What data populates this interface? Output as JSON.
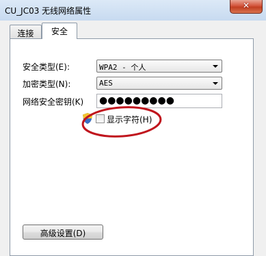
{
  "window": {
    "title": "CU_JC03 无线网络属性",
    "close_label": "✕"
  },
  "tabs": [
    {
      "label": "连接",
      "active": false
    },
    {
      "label": "安全",
      "active": true
    }
  ],
  "security": {
    "type_label": "安全类型(E):",
    "type_value": "WPA2 - 个人",
    "encryption_label": "加密类型(N):",
    "encryption_value": "AES",
    "key_label": "网络安全密钥(K)",
    "key_value": "●●●●●●●●●",
    "show_chars_label": "显示字符(H)",
    "show_chars_checked": false
  },
  "buttons": {
    "advanced_label": "高级设置(D)"
  },
  "colors": {
    "highlight_ring": "#c0151d",
    "close_button": "#c94b2d"
  }
}
